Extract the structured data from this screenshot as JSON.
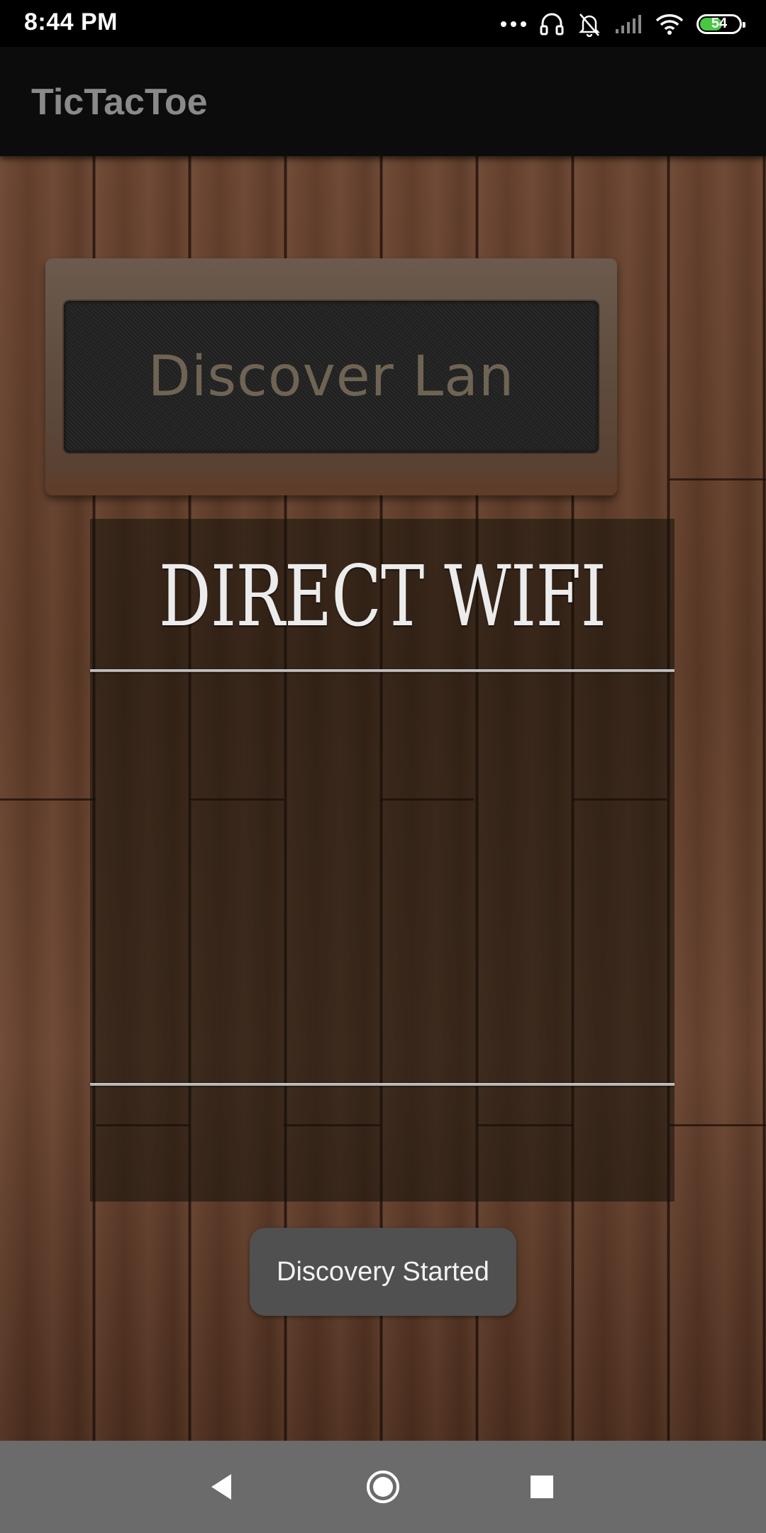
{
  "status_bar": {
    "time": "8:44 PM",
    "battery": "54",
    "icons": [
      "more-dots-icon",
      "headphones-icon",
      "bell-muted-icon",
      "signal-icon",
      "wifi-icon",
      "battery-icon"
    ]
  },
  "app_bar": {
    "title": "TicTacToe"
  },
  "main": {
    "discover_button_label": "Discover Lan",
    "wifi_panel_title": "DIRECT WIFI",
    "devices": []
  },
  "toast": {
    "message": "Discovery Started"
  },
  "nav_bar": {
    "icons": [
      "back-icon",
      "home-icon",
      "recents-icon"
    ]
  },
  "colors": {
    "app_bar_bg": "#0c0c0c",
    "title_text": "#8a8a8a",
    "battery_green": "#48c742",
    "nav_bar_bg": "#6b6b6b",
    "toast_bg": "#505050"
  }
}
